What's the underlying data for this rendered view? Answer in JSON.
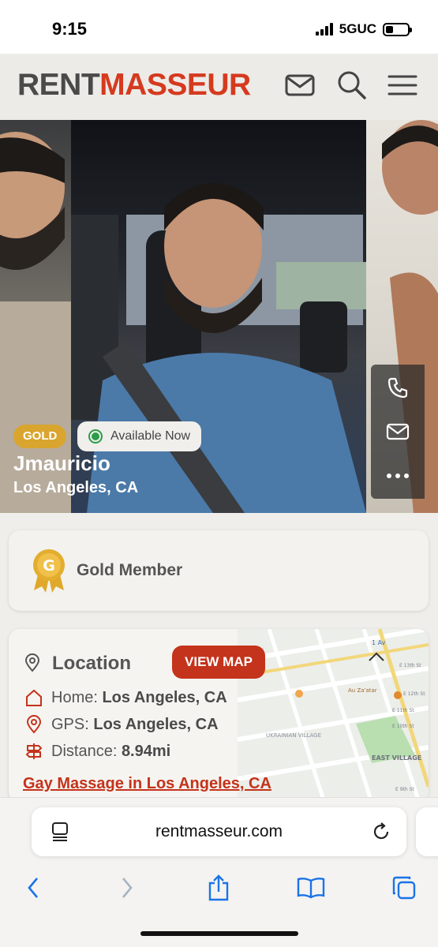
{
  "status_bar": {
    "time": "9:15",
    "network": "5GUC",
    "battery_level": 0.35
  },
  "header": {
    "logo_part1": "RENT",
    "logo_part2": "MASSEUR",
    "brand_color": "#d53a1f",
    "icons": [
      "mail-icon",
      "search-icon",
      "menu-icon"
    ]
  },
  "profile": {
    "membership_badge": "GOLD",
    "availability": "Available Now",
    "name": "Jmauricio",
    "city": "Los Angeles, CA",
    "contact_actions": [
      "phone-icon",
      "mail-icon",
      "more-icon"
    ]
  },
  "gold_card": {
    "medal_letter": "G",
    "label": "Gold Member"
  },
  "location": {
    "title": "Location",
    "view_map_label": "VIEW MAP",
    "home_label": "Home:",
    "home_value": "Los Angeles, CA",
    "gps_label": "GPS:",
    "gps_value": "Los Angeles, CA",
    "distance_label": "Distance:",
    "distance_value": "8.94mi",
    "link": "Gay Massage in Los Angeles, CA",
    "map_labels": [
      "1 Av",
      "UKRAINIAN VILLAGE",
      "EAST VILLAGE",
      "Au Za'atar",
      "E 13th St",
      "E 12th St",
      "E 11th St",
      "E 10th St",
      "E 9th St"
    ]
  },
  "browser": {
    "url": "rentmasseur.com"
  }
}
